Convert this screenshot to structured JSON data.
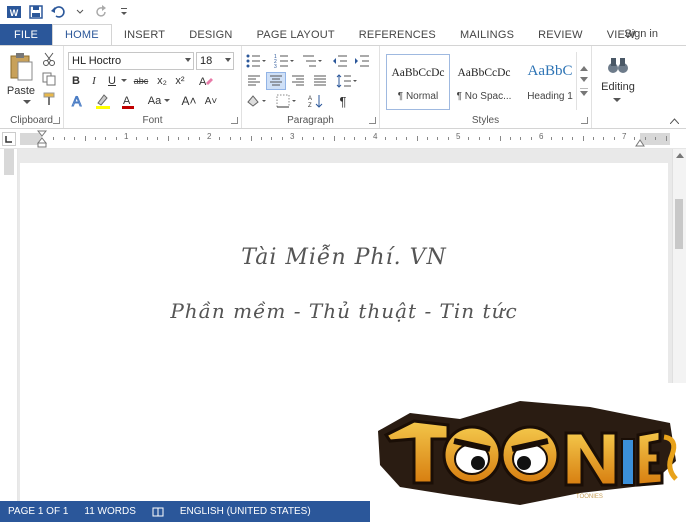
{
  "colors": {
    "accent": "#2b579a",
    "status_bar": "#2b579a",
    "logo_orange": "#e8a21a"
  },
  "quick_access": {
    "icons": [
      "word-app-icon",
      "save-icon",
      "undo-icon",
      "redo-icon"
    ]
  },
  "tabs": [
    {
      "label": "FILE"
    },
    {
      "label": "HOME"
    },
    {
      "label": "INSERT"
    },
    {
      "label": "DESIGN"
    },
    {
      "label": "PAGE LAYOUT"
    },
    {
      "label": "REFERENCES"
    },
    {
      "label": "MAILINGS"
    },
    {
      "label": "REVIEW"
    },
    {
      "label": "VIEW"
    }
  ],
  "account": {
    "signin": "Sign in"
  },
  "ribbon": {
    "clipboard": {
      "paste": "Paste",
      "label": "Clipboard"
    },
    "font": {
      "name": "HL Hoctro",
      "size": "18",
      "label": "Font",
      "bold": "B",
      "italic": "I",
      "underline": "U",
      "strike": "abc",
      "subscript": "x₂",
      "superscript": "x²",
      "case": "Aa",
      "grow": "A˄",
      "shrink": "A˅"
    },
    "paragraph": {
      "label": "Paragraph",
      "pilcrow": "¶"
    },
    "styles": {
      "label": "Styles",
      "items": [
        {
          "sample": "AaBbCcDc",
          "name": "¶ Normal"
        },
        {
          "sample": "AaBbCcDc",
          "name": "¶ No Spac..."
        },
        {
          "sample": "AaBbC",
          "name": "Heading 1"
        }
      ]
    },
    "editing": {
      "label": "Editing"
    }
  },
  "ruler": {
    "numbers": [
      "1",
      "2",
      "3",
      "4",
      "5",
      "6",
      "7"
    ]
  },
  "document": {
    "lines": [
      "Tài Miễn Phí. VN",
      "Phần mềm - Thủ thuật - Tin tức"
    ]
  },
  "status": {
    "page": "PAGE 1 OF 1",
    "words": "11 WORDS",
    "language": "ENGLISH (UNITED STATES)"
  },
  "logo": {
    "text": "TOONIES"
  }
}
